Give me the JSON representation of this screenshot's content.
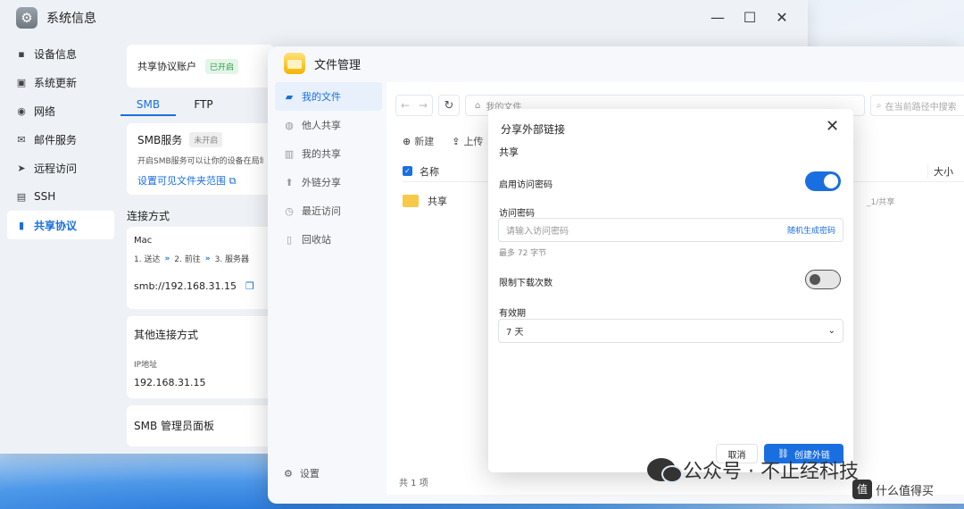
{
  "system_window": {
    "title": "系统信息",
    "controls": {
      "minimize": "—",
      "maximize": "☐",
      "close": "✕"
    },
    "sidebar": [
      {
        "label": "设备信息",
        "icon": "hdd-icon",
        "glyph": "▪"
      },
      {
        "label": "系统更新",
        "icon": "update-icon",
        "glyph": "▣"
      },
      {
        "label": "网络",
        "icon": "globe-icon",
        "glyph": "◉"
      },
      {
        "label": "邮件服务",
        "icon": "mail-icon",
        "glyph": "✉"
      },
      {
        "label": "远程访问",
        "icon": "send-icon",
        "glyph": "➤"
      },
      {
        "label": "SSH",
        "icon": "terminal-icon",
        "glyph": "▤"
      },
      {
        "label": "共享协议",
        "icon": "document-icon",
        "glyph": "▮",
        "active": true
      }
    ],
    "account": {
      "label": "共享协议账户",
      "status": "已开启"
    },
    "tabs": [
      "SMB",
      "FTP"
    ],
    "smb": {
      "title": "SMB服务",
      "status": "未开启",
      "desc": "开启SMB服务可以让你的设备在局域",
      "link": "设置可见文件夹范围"
    },
    "connect_heading": "连接方式",
    "mac": {
      "label": "Mac",
      "step1": "1. 送达",
      "step2": "2. 前往",
      "step3": "3. 服务器",
      "address": "smb://192.168.31.15"
    },
    "other": {
      "title": "其他连接方式",
      "ip_label": "IP地址",
      "ip_value": "192.168.31.15"
    },
    "panel": "SMB 管理员面板"
  },
  "file_manager": {
    "title": "文件管理",
    "sidebar": [
      {
        "label": "我的文件",
        "icon": "folder-icon",
        "glyph": "▰",
        "active": true
      },
      {
        "label": "他人共享",
        "icon": "users-icon",
        "glyph": "◍"
      },
      {
        "label": "我的共享",
        "icon": "share-icon",
        "glyph": "▥"
      },
      {
        "label": "外链分享",
        "icon": "link-share-icon",
        "glyph": "⬆"
      },
      {
        "label": "最近访问",
        "icon": "clock-icon",
        "glyph": "◷"
      },
      {
        "label": "回收站",
        "icon": "trash-icon",
        "glyph": "▯"
      }
    ],
    "settings": "设置",
    "path": "我的文件",
    "search_placeholder": "在当前路径中搜索",
    "toolbar": {
      "new": "新建",
      "upload": "上传"
    },
    "columns": {
      "name": "名称",
      "size": "大小"
    },
    "rows": [
      {
        "name": "共享",
        "path": "_1/共享"
      }
    ],
    "footer": "共 1 项"
  },
  "modal": {
    "title": "分享外部链接",
    "section": "共享",
    "enable_password": {
      "label": "启用访问密码",
      "on": true
    },
    "password": {
      "label": "访问密码",
      "placeholder": "请输入访问密码",
      "generate": "随机生成密码",
      "hint": "最多 72 字节"
    },
    "limit_downloads": {
      "label": "限制下载次数",
      "on": false
    },
    "validity": {
      "label": "有效期",
      "value": "7 天"
    },
    "cancel": "取消",
    "create": "创建外链"
  },
  "watermark": {
    "text": "公众号 · 不止经科技",
    "site": "什么值得买",
    "badge": "值"
  },
  "colors": {
    "accent": "#1a6fe0",
    "on_badge": "#2a9d4b",
    "folder": "#f7c948"
  }
}
